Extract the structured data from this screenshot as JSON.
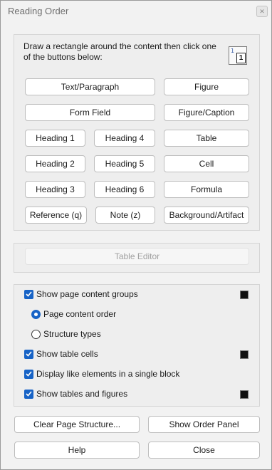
{
  "window": {
    "title": "Reading Order"
  },
  "instructions": "Draw a rectangle around the content then click one of the buttons below:",
  "tag_buttons": {
    "text_paragraph": "Text/Paragraph",
    "figure": "Figure",
    "form_field": "Form Field",
    "figure_caption": "Figure/Caption",
    "heading1": "Heading 1",
    "heading4": "Heading 4",
    "table": "Table",
    "heading2": "Heading 2",
    "heading5": "Heading 5",
    "cell": "Cell",
    "heading3": "Heading 3",
    "heading6": "Heading 6",
    "formula": "Formula",
    "reference": "Reference (q)",
    "note": "Note (z)",
    "background": "Background/Artifact"
  },
  "table_editor": "Table Editor",
  "options": {
    "show_groups": {
      "label": "Show page content groups",
      "checked": true,
      "color": "#000000"
    },
    "page_content_order": {
      "label": "Page content order",
      "selected": true
    },
    "structure_types": {
      "label": "Structure types",
      "selected": false
    },
    "show_table_cells": {
      "label": "Show table cells",
      "checked": true,
      "color": "#000000"
    },
    "display_like": {
      "label": "Display like elements in a single block",
      "checked": true
    },
    "show_tables_figures": {
      "label": "Show tables and figures",
      "checked": true,
      "color": "#000000"
    }
  },
  "actions": {
    "clear": "Clear Page Structure...",
    "show_order": "Show Order Panel",
    "help": "Help",
    "close": "Close"
  },
  "accent": "#1763c6"
}
